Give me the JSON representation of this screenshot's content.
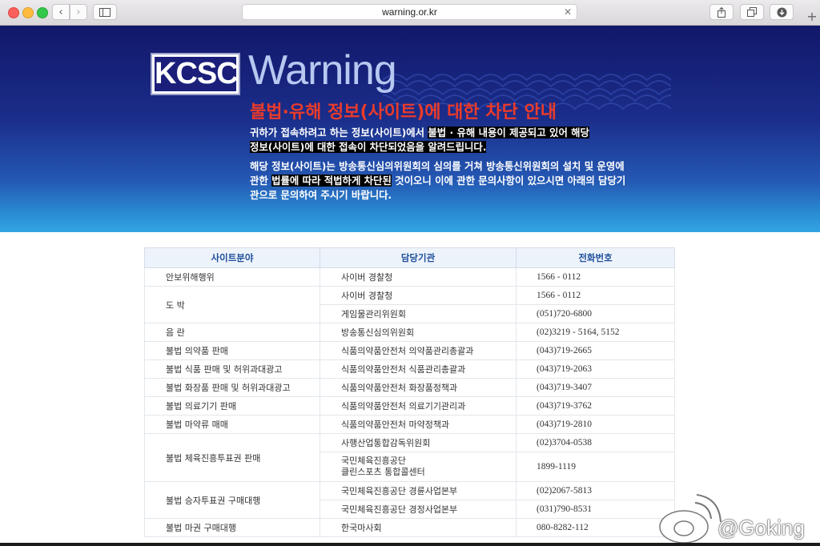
{
  "browser": {
    "url": "warning.or.kr",
    "icons": [
      "back-chevron",
      "forward-chevron",
      "sidebar",
      "share",
      "tabs",
      "download",
      "close",
      "plus"
    ]
  },
  "banner": {
    "logo": "KCSC",
    "warning_word": "Warning",
    "title": "불법·유해 정보(사이트)에 대한 차단 안내",
    "para1_a": "귀하가 접속하려고 하는 정보(사이트)에서 ",
    "para1_hl1": "불법 · 유해 내용이 제공되고 있어 해당",
    "para1_hl2": "정보(사이트)에 대한 접속이 차단되었음을 알려드립니다.",
    "para2_a": "해당 정보(사이트)는 방송통신심의위원회의 심의를 거쳐 방송통신위원회의 설치 및 운영에 관한 ",
    "para2_hl": "법률에 따라 적법하게 차단된",
    "para2_b": " 것이오니 이에 관한 문의사항이 있으시면 아래의 담당기관으로  문의하여 주시기 바랍니다."
  },
  "table": {
    "headers": [
      "사이트분야",
      "담당기관",
      "전화번호"
    ],
    "rows": [
      {
        "field": "안보위해행위",
        "agency": "사이버 경찰청",
        "phone": "1566 - 0112"
      },
      {
        "field": "도 박",
        "agency": "사이버 경찰청",
        "phone": "1566 - 0112"
      },
      {
        "field": "",
        "agency": "게임물관리위원회",
        "phone": "(051)720-6800"
      },
      {
        "field": "음 란",
        "agency": "방송통신심의위원회",
        "phone": "(02)3219 - 5164, 5152"
      },
      {
        "field": "불법 의약품 판매",
        "agency": "식품의약품안전처 의약품관리총괄과",
        "phone": "(043)719-2665"
      },
      {
        "field": "불법 식품 판매 및 허위과대광고",
        "agency": "식품의약품안전처 식품관리총괄과",
        "phone": "(043)719-2063"
      },
      {
        "field": "불법 화장품 판매 및 허위과대광고",
        "agency": "식품의약품안전처 화장품정책과",
        "phone": "(043)719-3407"
      },
      {
        "field": "불법 의료기기 판매",
        "agency": "식품의약품안전처 의료기기관리과",
        "phone": "(043)719-3762"
      },
      {
        "field": "불법 마약류 매매",
        "agency": "식품의약품안전처 마약정책과",
        "phone": "(043)719-2810"
      },
      {
        "field": "불법 체육진흥투표권 판매",
        "agency": "사행산업통합감독위원회",
        "phone": "(02)3704-0538"
      },
      {
        "field": "",
        "agency_l1": "국민체육진흥공단",
        "agency_l2": "클린스포츠 통합콜센터",
        "phone": "1899-1119"
      },
      {
        "field": "불법 승자투표권 구매대행",
        "agency": "국민체육진흥공단 경륜사업본부",
        "phone": "(02)2067-5813"
      },
      {
        "field": "",
        "agency": "국민체육진흥공단 경정사업본부",
        "phone": "(031)790-8531"
      },
      {
        "field": "불법 마권 구매대행",
        "agency": "한국마사회",
        "phone": "080-8282-112"
      }
    ]
  },
  "watermark": {
    "text": "@Goking"
  }
}
